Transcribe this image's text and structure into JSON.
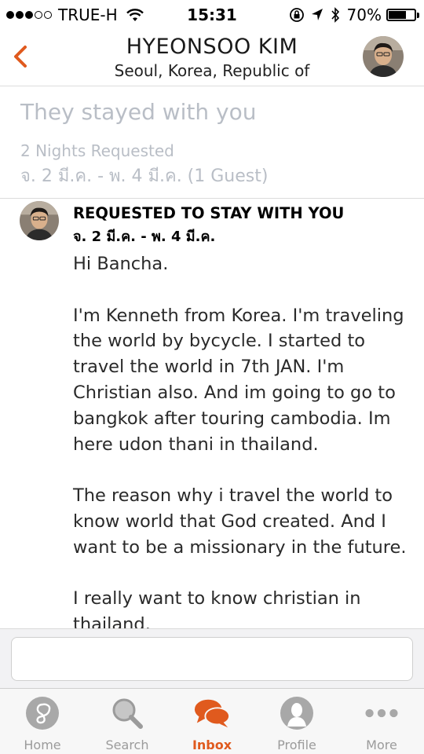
{
  "status_bar": {
    "carrier": "TRUE-H",
    "time": "15:31",
    "battery": "70%",
    "battery_level": 0.7
  },
  "header": {
    "title": "HYEONSOO KIM",
    "subtitle": "Seoul, Korea, Republic of",
    "back_icon": "chevron-left-icon"
  },
  "summary": {
    "title": "They stayed with you",
    "nights": "2 Nights Requested",
    "dates": "จ. 2 มี.ค. - พ. 4 มี.ค. (1 Guest)"
  },
  "message": {
    "heading": "REQUESTED TO STAY WITH YOU",
    "dates": "จ. 2 มี.ค. - พ. 4 มี.ค.",
    "paragraphs": [
      "Hi Bancha.",
      "I'm Kenneth from Korea. I'm traveling the world by bycycle. I started to travel the world in 7th JAN. I'm Christian also. And im going to go to bangkok after touring cambodia. Im here udon thani in thailand.",
      "The reason why i travel the world to know world that God created. And I want to be a missionary in the future.",
      "I really want to know christian in thailand."
    ]
  },
  "reply": {
    "placeholder": ""
  },
  "tabs": [
    {
      "label": "Home",
      "icon": "couchsurfing-logo-icon",
      "active": false
    },
    {
      "label": "Search",
      "icon": "search-icon",
      "active": false
    },
    {
      "label": "Inbox",
      "icon": "chat-bubbles-icon",
      "active": true
    },
    {
      "label": "Profile",
      "icon": "profile-icon",
      "active": false
    },
    {
      "label": "More",
      "icon": "more-dots-icon",
      "active": false
    }
  ],
  "colors": {
    "accent": "#e05a1e",
    "muted": "#b9bec6",
    "tab_inactive": "#9b9b9b"
  }
}
